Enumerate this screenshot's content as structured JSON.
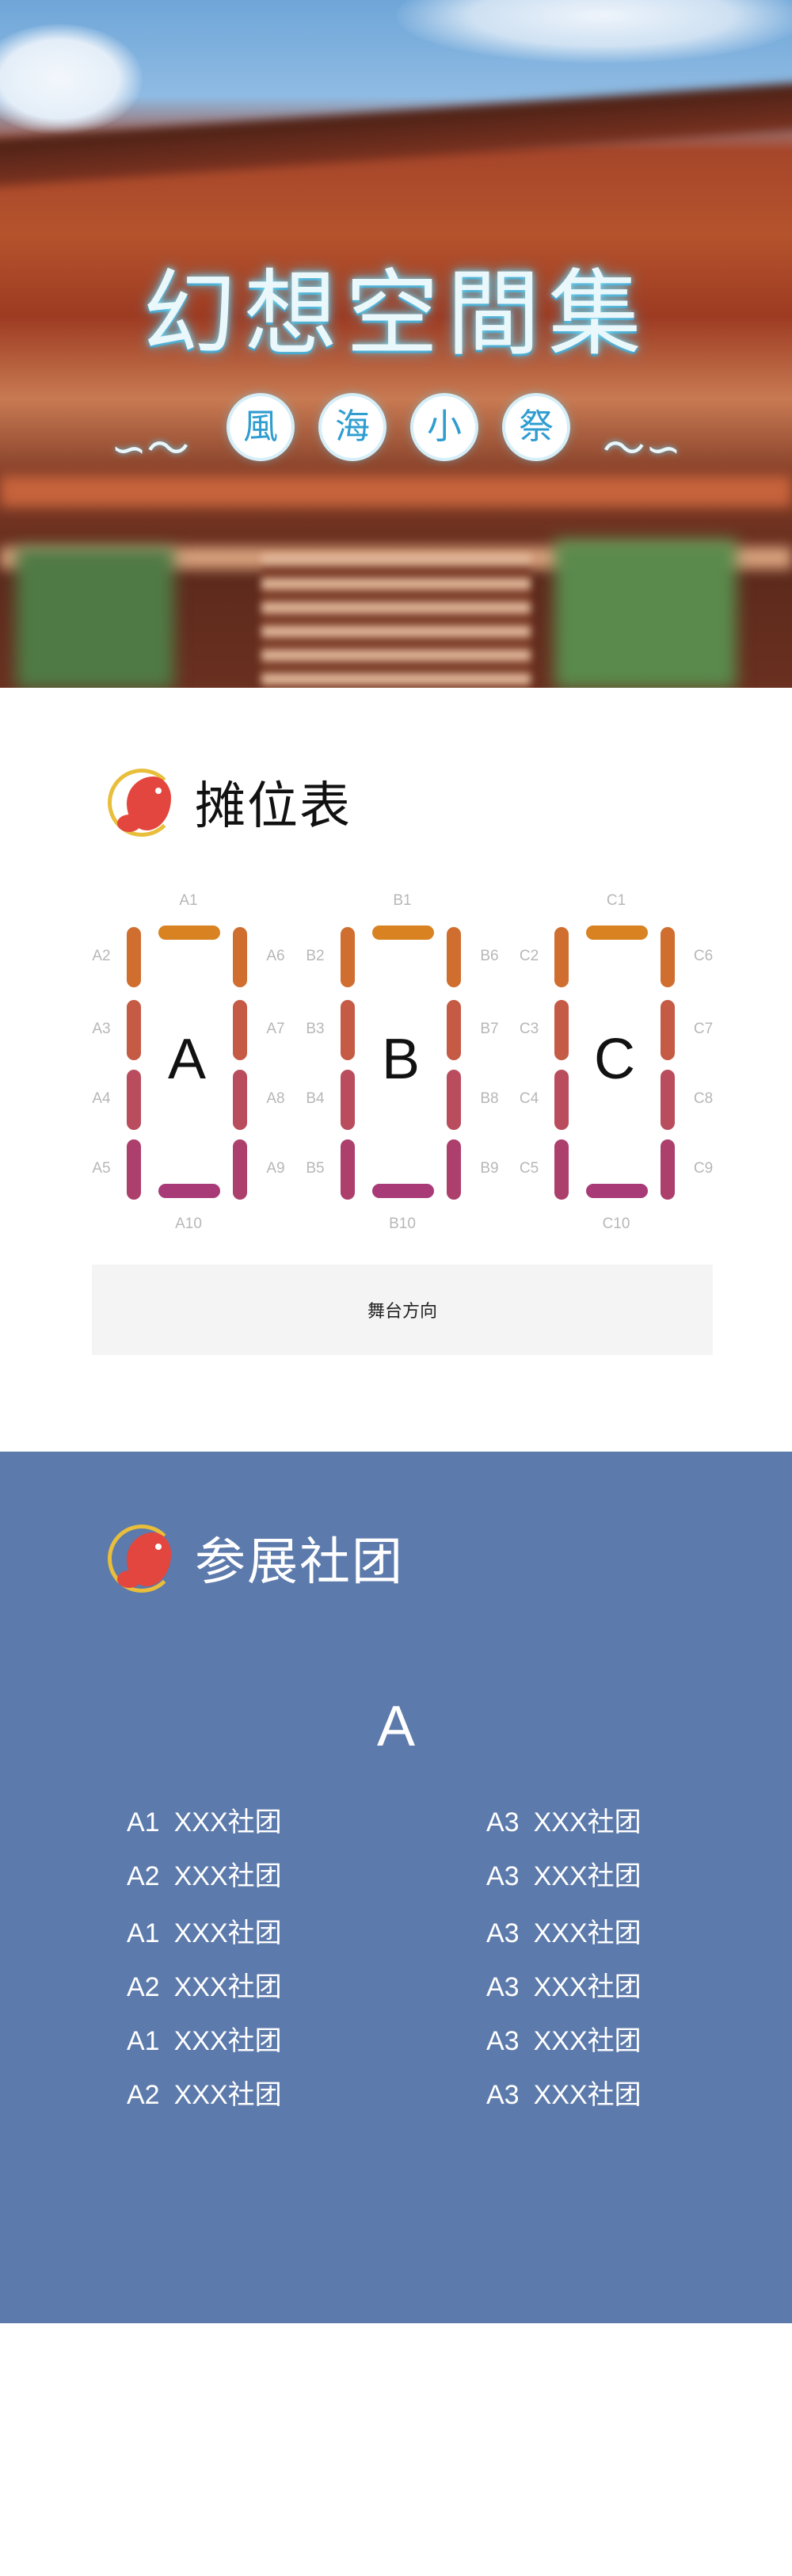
{
  "hero": {
    "title": "幻想空間集",
    "subtitle_chars": [
      "風",
      "海",
      "小",
      "祭"
    ]
  },
  "booth_section": {
    "title": "摊位表",
    "stage_label": "舞台方向",
    "groups": [
      {
        "letter": "A",
        "top": "A1",
        "left": [
          "A2",
          "A3",
          "A4",
          "A5"
        ],
        "right": [
          "A6",
          "A7",
          "A8",
          "A9"
        ],
        "bottom": "A10"
      },
      {
        "letter": "B",
        "top": "B1",
        "left": [
          "B2",
          "B3",
          "B4",
          "B5"
        ],
        "right": [
          "B6",
          "B7",
          "B8",
          "B9"
        ],
        "bottom": "B10"
      },
      {
        "letter": "C",
        "top": "C1",
        "left": [
          "C2",
          "C3",
          "C4",
          "C5"
        ],
        "right": [
          "C6",
          "C7",
          "C8",
          "C9"
        ],
        "bottom": "C10"
      }
    ],
    "colors": {
      "top": "#d98222",
      "row1": "#cf6e2f",
      "row2": "#c55a45",
      "row3": "#b94d5d",
      "row4": "#ac3f6c",
      "bottom": "#a83a78"
    }
  },
  "clubs_section": {
    "title": "参展社团",
    "background": "#5c7aab",
    "group_letter": "A",
    "left_column": [
      {
        "code": "A1",
        "name": "XXX社团"
      },
      {
        "code": "A2",
        "name": "XXX社团"
      },
      {
        "code": "A1",
        "name": "XXX社团"
      },
      {
        "code": "A2",
        "name": "XXX社团"
      },
      {
        "code": "A1",
        "name": "XXX社团"
      },
      {
        "code": "A2",
        "name": "XXX社团"
      }
    ],
    "right_column": [
      {
        "code": "A3",
        "name": "XXX社团"
      },
      {
        "code": "A3",
        "name": "XXX社团"
      },
      {
        "code": "A3",
        "name": "XXX社团"
      },
      {
        "code": "A3",
        "name": "XXX社团"
      },
      {
        "code": "A3",
        "name": "XXX社团"
      },
      {
        "code": "A3",
        "name": "XXX社团"
      }
    ]
  }
}
